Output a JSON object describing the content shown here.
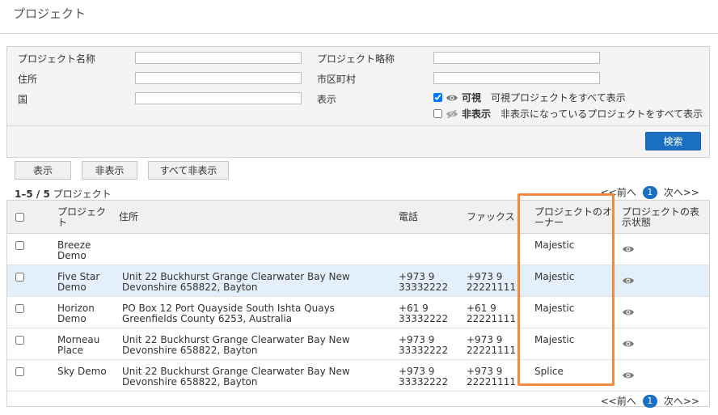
{
  "page": {
    "title": "プロジェクト"
  },
  "filter": {
    "project_name_label": "プロジェクト名称",
    "project_abbr_label": "プロジェクト略称",
    "address_label": "住所",
    "city_label": "市区町村",
    "country_label": "国",
    "display_label": "表示",
    "project_name_value": "",
    "project_abbr_value": "",
    "address_value": "",
    "city_value": "",
    "country_value": "",
    "visible": {
      "label": "可視",
      "desc": "可視プロジェクトをすべて表示",
      "checked": true
    },
    "hidden": {
      "label": "非表示",
      "desc": "非表示になっているプロジェクトをすべて表示",
      "checked": false
    },
    "search_button": "検索"
  },
  "actions": {
    "show": "表示",
    "hide": "非表示",
    "hide_all": "すべて非表示"
  },
  "summary": {
    "range": "1–5 / 5",
    "unit": "プロジェクト"
  },
  "pager": {
    "prev": "<<前へ",
    "current": "1",
    "next": "次へ>>"
  },
  "table": {
    "headers": {
      "project": "プロジェクト",
      "address": "住所",
      "phone": "電話",
      "fax": "ファックス",
      "owner": "プロジェクトのオーナー",
      "visibility": "プロジェクトの表示状態"
    },
    "rows": [
      {
        "project": "Breeze Demo",
        "address": "",
        "phone": "",
        "fax": "",
        "owner": "Majestic",
        "visible": "visible"
      },
      {
        "project": "Five Star Demo",
        "address": "Unit 22 Buckhurst Grange Clearwater Bay New Devonshire 658822, Bayton",
        "phone": "+973 9 33332222",
        "fax": "+973 9 22221111",
        "owner": "Majestic",
        "visible": "visible"
      },
      {
        "project": "Horizon Demo",
        "address": "PO Box 12 Port Quayside South Ishta Quays Greenfields County 6253, Australia",
        "phone": "+61 9 33332222",
        "fax": "+61 9 22221111",
        "owner": "Majestic",
        "visible": "visible"
      },
      {
        "project": "Morneau Place",
        "address": "Unit 22 Buckhurst Grange Clearwater Bay New Devonshire 658822, Bayton",
        "phone": "+973 9 33332222",
        "fax": "+973 9 22221111",
        "owner": "Majestic",
        "visible": "visible"
      },
      {
        "project": "Sky Demo",
        "address": "Unit 22 Buckhurst Grange Clearwater Bay New Devonshire 658822, Bayton",
        "phone": "+973 9 33332222",
        "fax": "+973 9 22221111",
        "owner": "Splice",
        "visible": "visible"
      }
    ]
  },
  "colors": {
    "accent": "#1b6fc2",
    "highlight": "#f58a3d",
    "row_alt": "#e3f0fb"
  }
}
